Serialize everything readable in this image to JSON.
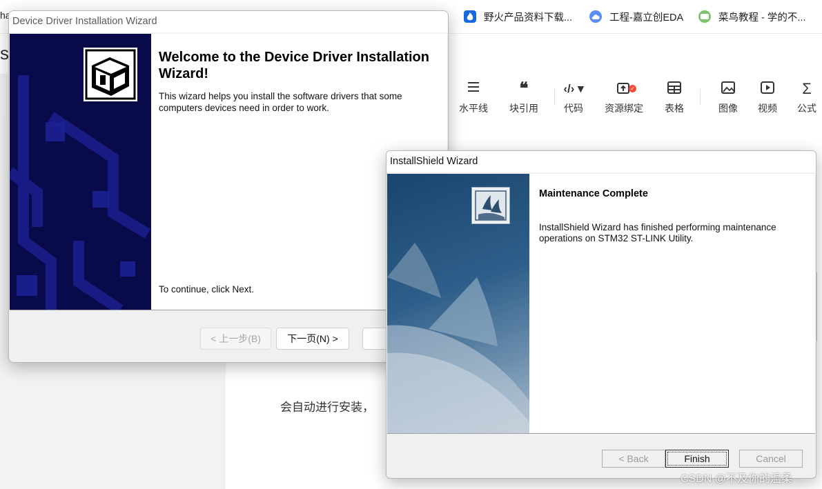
{
  "browser": {
    "bookmark_partial": "ha",
    "bookmark_dot": ".",
    "bookmarks": [
      {
        "label": "野火产品资料下载..."
      },
      {
        "label": "工程-嘉立创EDA"
      },
      {
        "label": "菜鸟教程 - 学的不..."
      }
    ],
    "editor_initial": "s"
  },
  "editor_toolbar": {
    "items": [
      {
        "label": "水平线",
        "icon": "horizontal-rule-icon"
      },
      {
        "label": "块引用",
        "icon": "quote-icon"
      },
      {
        "label": "代码",
        "icon": "code-icon"
      },
      {
        "label": "资源绑定",
        "icon": "resource-bind-icon"
      },
      {
        "label": "表格",
        "icon": "table-icon"
      },
      {
        "label": "图像",
        "icon": "image-icon"
      },
      {
        "label": "视频",
        "icon": "video-icon"
      },
      {
        "label": "公式",
        "icon": "formula-icon"
      }
    ]
  },
  "content": {
    "text": "会自动进行安装，"
  },
  "watermark": "CSDN @不及你的温柔",
  "driver_wizard": {
    "title": "Device Driver Installation Wizard",
    "heading": "Welcome to the Device Driver Installation Wizard!",
    "description": "This wizard helps you install the software drivers that some computers devices need in order to work.",
    "continue_text": "To continue, click Next.",
    "back_label": "< 上一步(B)",
    "next_label": "下一页(N) >",
    "cancel_label": ""
  },
  "installshield": {
    "title": "InstallShield Wizard",
    "heading": "Maintenance Complete",
    "description": "InstallShield Wizard has finished performing maintenance operations on STM32 ST-LINK Utility.",
    "back_label": "< Back",
    "finish_label": "Finish",
    "cancel_label": "Cancel"
  }
}
